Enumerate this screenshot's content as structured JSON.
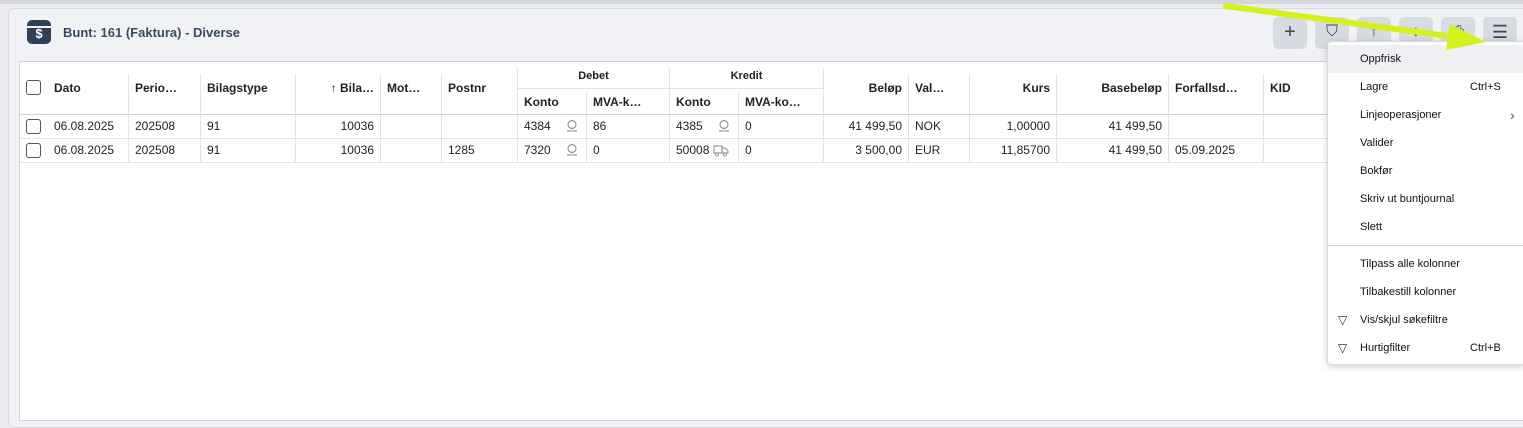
{
  "header": {
    "logo_glyph": "$",
    "title": "Bunt: 161 (Faktura) - Diverse"
  },
  "toolbar": {
    "add_glyph": "+",
    "filter_glyph": "⛉",
    "sort_up_glyph": "↑",
    "sort_down_glyph": "↓",
    "print_glyph": "⎙",
    "menu_glyph": "☰"
  },
  "columns": {
    "dato": "Dato",
    "periode": "Perio…",
    "bilagstype": "Bilagstype",
    "bilag": "↑ Bila…",
    "mot": "Mot…",
    "postnr": "Postnr",
    "debet": "Debet",
    "kredit": "Kredit",
    "konto": "Konto",
    "mva_k": "MVA-k…",
    "konto2": "Konto",
    "mva_ko": "MVA-ko…",
    "belop": "Beløp",
    "valuta": "Val…",
    "kurs": "Kurs",
    "basebelop": "Basebeløp",
    "forfall": "Forfallsd…",
    "kid": "KID"
  },
  "rows": [
    {
      "dato": "06.08.2025",
      "periode": "202508",
      "bilagstype": "91",
      "bilag": "10036",
      "mot": "",
      "postnr": "",
      "debet_konto": "4384",
      "debet_mva": "86",
      "kredit_konto": "4385",
      "kredit_mva": "0",
      "belop": "41 499,50",
      "valuta": "NOK",
      "kurs": "1,00000",
      "basebelop": "41 499,50",
      "forfall": "",
      "kid": ""
    },
    {
      "dato": "06.08.2025",
      "periode": "202508",
      "bilagstype": "91",
      "bilag": "10036",
      "mot": "",
      "postnr": "1285",
      "debet_konto": "7320",
      "debet_mva": "0",
      "kredit_konto": "50008",
      "kredit_mva": "0",
      "belop": "3 500,00",
      "valuta": "EUR",
      "kurs": "11,85700",
      "basebelop": "41 499,50",
      "forfall": "05.09.2025",
      "kid": ""
    }
  ],
  "menu": {
    "items": [
      {
        "label": "Oppfrisk",
        "shortcut": ""
      },
      {
        "label": "Lagre",
        "shortcut": "Ctrl+S"
      },
      {
        "label": "Linjeoperasjoner",
        "shortcut": "",
        "arrow": "›"
      },
      {
        "label": "Valider",
        "shortcut": ""
      },
      {
        "label": "Bokfør",
        "shortcut": ""
      },
      {
        "label": "Skriv ut buntjournal",
        "shortcut": ""
      },
      {
        "label": "Slett",
        "shortcut": ""
      },
      {
        "label": "Tilpass alle kolonner",
        "shortcut": ""
      },
      {
        "label": "Tilbakestill kolonner",
        "shortcut": ""
      },
      {
        "label": "Vis/skjul søkefiltre",
        "shortcut": "",
        "icon": "▽"
      },
      {
        "label": "Hurtigfilter",
        "shortcut": "Ctrl+B",
        "icon": "▽"
      }
    ]
  },
  "colors": {
    "accent_arrow": "#d4f01e",
    "header_text": "#3a4a5e",
    "logo_bg": "#2f3f55"
  }
}
